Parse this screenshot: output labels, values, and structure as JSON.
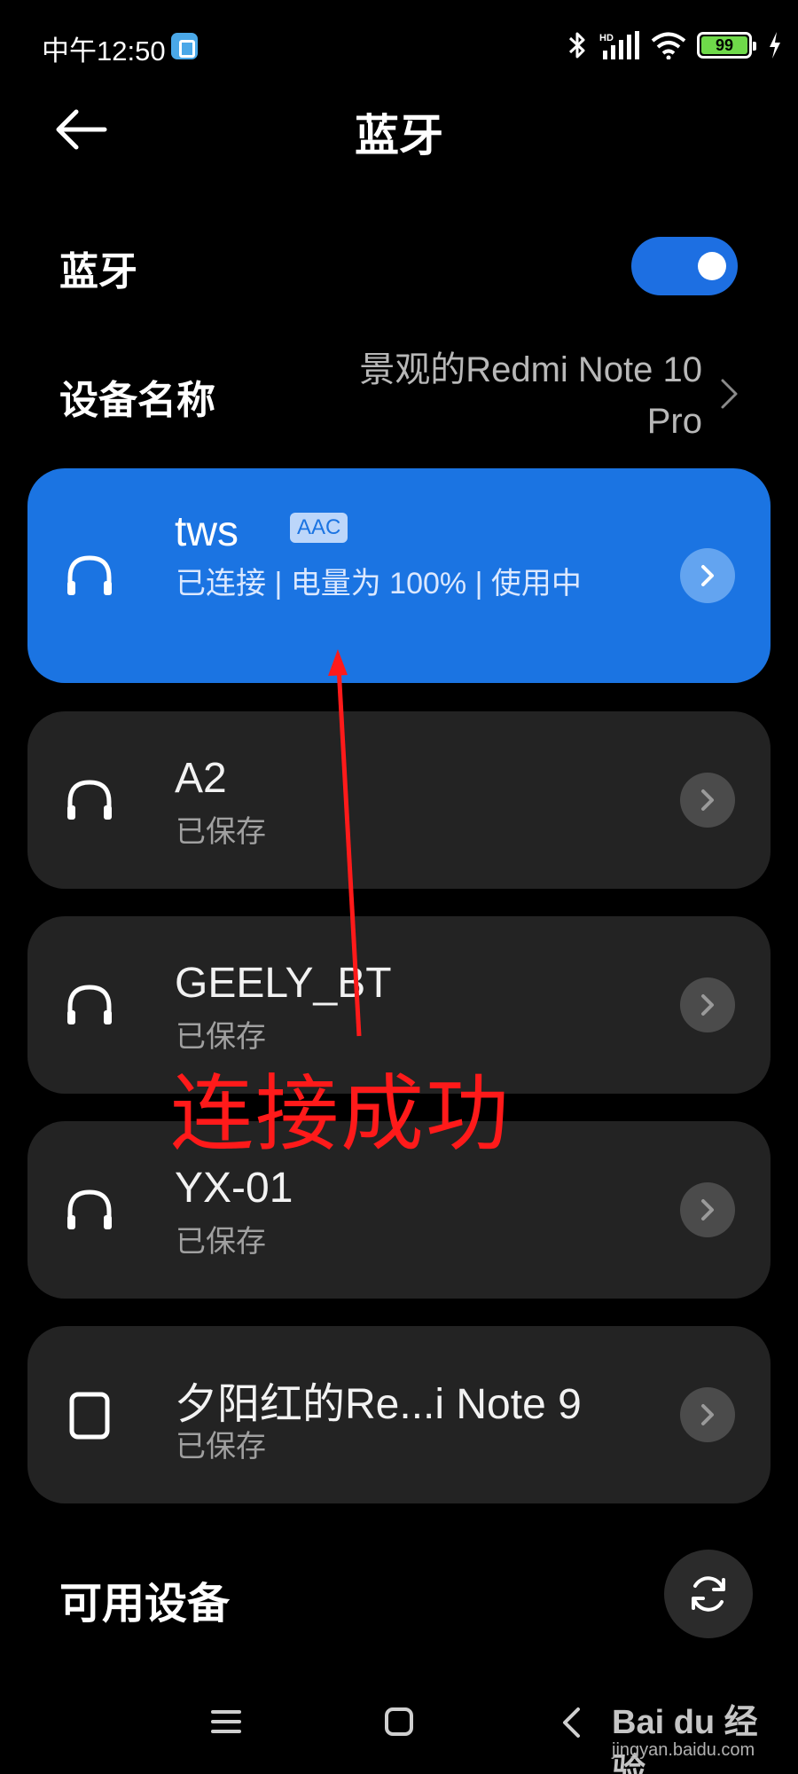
{
  "status_bar": {
    "time": "中午12:50",
    "network_label": "HD",
    "battery": "99"
  },
  "header": {
    "title": "蓝牙"
  },
  "bluetooth": {
    "label": "蓝牙",
    "enabled": true,
    "toggle_color": "#1b74e2"
  },
  "device_name": {
    "label": "设备名称",
    "value": "景观的Redmi Note 10 Pro"
  },
  "devices": [
    {
      "name": "tws",
      "badge": "AAC",
      "status": "已连接 | 电量为 100% | 使用中",
      "icon": "headphones-icon",
      "connected": true
    },
    {
      "name": "A2",
      "status": "已保存",
      "icon": "headphones-icon",
      "connected": false
    },
    {
      "name": "GEELY_BT",
      "status": "已保存",
      "icon": "headphones-icon",
      "connected": false
    },
    {
      "name": "YX-01",
      "status": "已保存",
      "icon": "headphones-icon",
      "connected": false
    },
    {
      "name": "夕阳红的Re...i Note 9",
      "status": "已保存",
      "icon": "phone-icon",
      "connected": false
    }
  ],
  "available": {
    "label": "可用设备"
  },
  "annotation": {
    "text": "连接成功",
    "color": "#ff1a1a"
  },
  "watermark": {
    "logo": "Bai du 经验",
    "url": "jingyan.baidu.com"
  }
}
